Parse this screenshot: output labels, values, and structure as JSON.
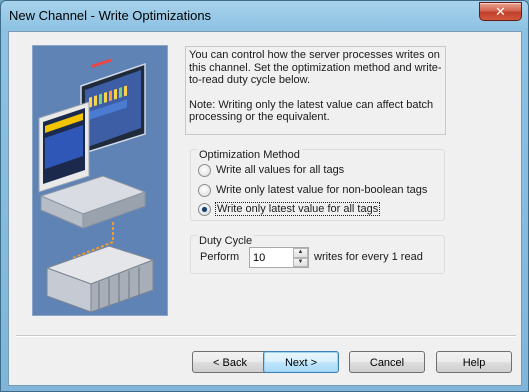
{
  "window": {
    "title": "New Channel - Write Optimizations",
    "close_glyph": "✕"
  },
  "description": {
    "paragraph1": "You can control how the server processes writes on this channel.  Set the optimization method and write-to-read duty cycle below.",
    "paragraph2": "Note:  Writing only the latest value can affect batch processing or the equivalent."
  },
  "optimization": {
    "title": "Optimization Method",
    "options": [
      {
        "label": "Write all values for all tags",
        "selected": false
      },
      {
        "label": "Write only latest value for non-boolean tags",
        "selected": false
      },
      {
        "label": "Write only latest value for all tags",
        "selected": true
      }
    ]
  },
  "duty_cycle": {
    "title": "Duty Cycle",
    "perform_label": "Perform",
    "value": "10",
    "writes_label": "writes for every 1 read"
  },
  "buttons": {
    "back": "< Back",
    "next": "Next >",
    "cancel": "Cancel",
    "help": "Help"
  },
  "icons": {
    "close": "close-icon",
    "spin_up": "up-arrow-icon",
    "spin_down": "down-arrow-icon"
  },
  "colors": {
    "title_bar": "#8cc1e2",
    "close_button": "#c13f2a",
    "art_background": "#5f83b4",
    "default_button": "#bee6fd"
  }
}
